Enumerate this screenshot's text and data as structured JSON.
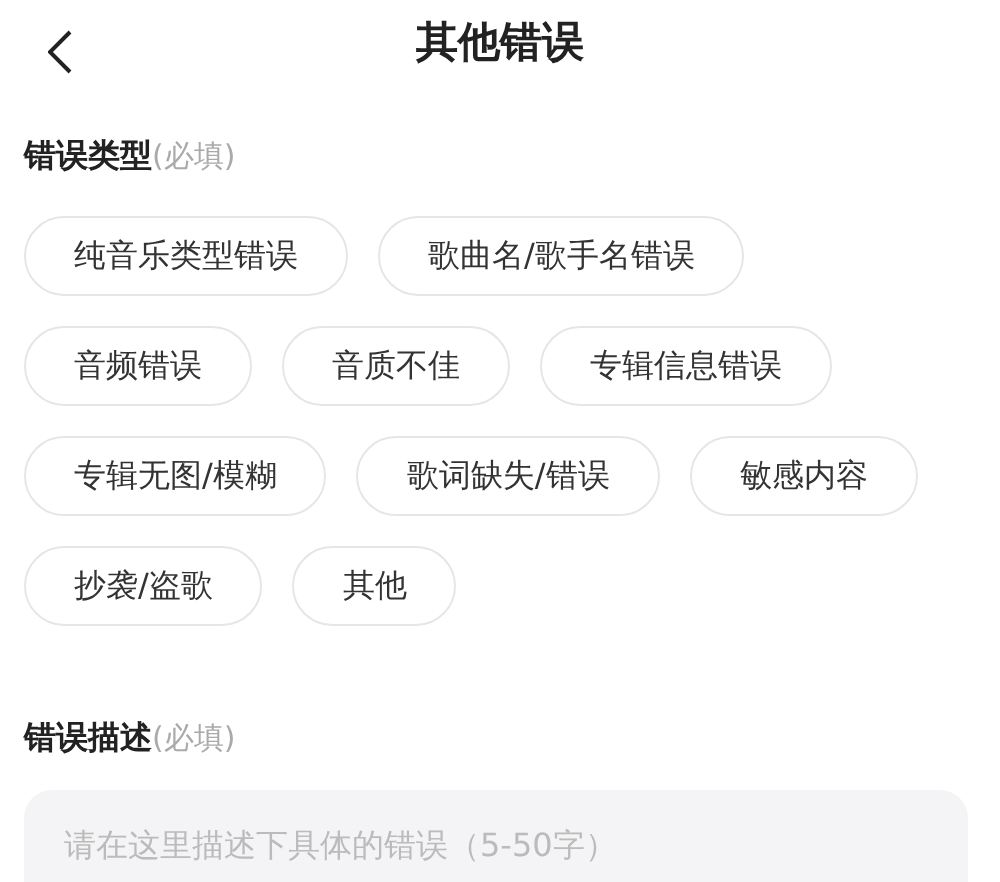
{
  "header": {
    "title": "其他错误"
  },
  "error_type": {
    "label": "错误类型",
    "hint": "(必填)",
    "options": [
      {
        "label": "纯音乐类型错误",
        "selected": false
      },
      {
        "label": "歌曲名/歌手名错误",
        "selected": false
      },
      {
        "label": "音频错误",
        "selected": false
      },
      {
        "label": "音质不佳",
        "selected": false
      },
      {
        "label": "专辑信息错误",
        "selected": false
      },
      {
        "label": "专辑无图/模糊",
        "selected": false
      },
      {
        "label": "歌词缺失/错误",
        "selected": false
      },
      {
        "label": "敏感内容",
        "selected": false
      },
      {
        "label": "抄袭/盗歌",
        "selected": false
      },
      {
        "label": "其他",
        "selected": false
      }
    ]
  },
  "description": {
    "label": "错误描述",
    "hint": "(必填)",
    "placeholder": "请在这里描述下具体的错误（5-50字）"
  }
}
